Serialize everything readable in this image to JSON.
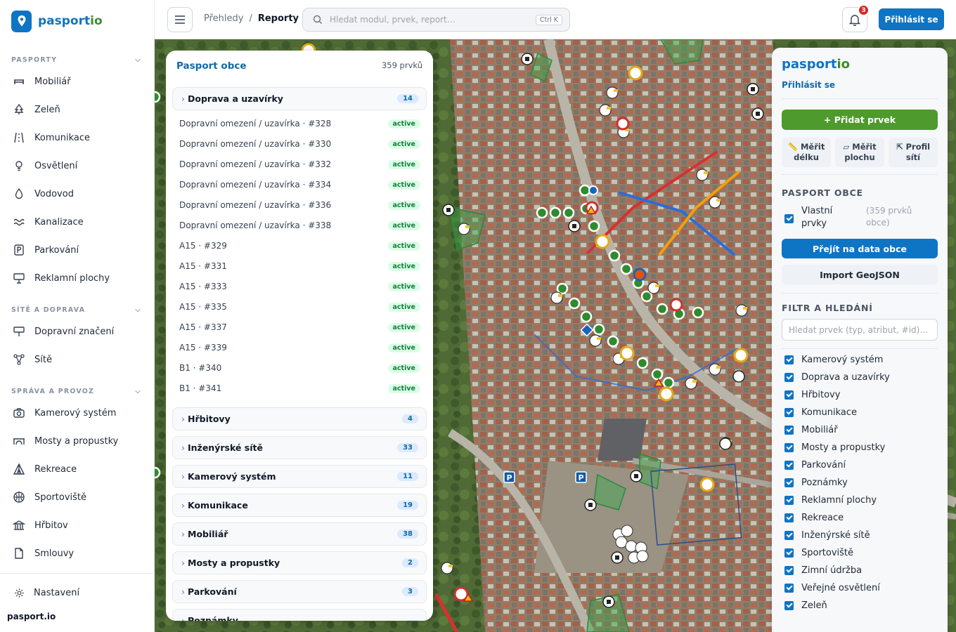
{
  "app": {
    "name_main": "pasport",
    "name_io": "io",
    "footer": "pasport.io"
  },
  "sidebar": {
    "sections": [
      {
        "label": "PASPORTY",
        "items": [
          "Mobiliář",
          "Zeleň",
          "Komunikace",
          "Osvětlení",
          "Vodovod",
          "Kanalizace",
          "Parkování",
          "Reklamní plochy"
        ]
      },
      {
        "label": "SÍTĚ A DOPRAVA",
        "items": [
          "Dopravní značení",
          "Sítě"
        ]
      },
      {
        "label": "SPRÁVA A PROVOZ",
        "items": [
          "Kamerový systém",
          "Mosty a propustky",
          "Rekreace",
          "Sportoviště",
          "Hřbitov",
          "Smlouvy"
        ]
      }
    ],
    "settings": "Nastavení"
  },
  "topbar": {
    "crumb_parent": "Přehledy",
    "crumb_sep": "/",
    "crumb_current": "Reporty",
    "search_placeholder": "Hledat modul, prvek, report…",
    "shortcut": "Ctrl K",
    "notifications": "3",
    "login": "Přihlásit se"
  },
  "list_panel": {
    "title": "Pasport obce",
    "count": "359 prvků",
    "open_group": {
      "name": "Doprava a uzavírky",
      "count": "14"
    },
    "rows": [
      {
        "name": "Dopravní omezení / uzavírka · #328",
        "status": "active"
      },
      {
        "name": "Dopravní omezení / uzavírka · #330",
        "status": "active"
      },
      {
        "name": "Dopravní omezení / uzavírka · #332",
        "status": "active"
      },
      {
        "name": "Dopravní omezení / uzavírka · #334",
        "status": "active"
      },
      {
        "name": "Dopravní omezení / uzavírka · #336",
        "status": "active"
      },
      {
        "name": "Dopravní omezení / uzavírka · #338",
        "status": "active"
      },
      {
        "name": "A15 · #329",
        "status": "active"
      },
      {
        "name": "A15 · #331",
        "status": "active"
      },
      {
        "name": "A15 · #333",
        "status": "active"
      },
      {
        "name": "A15 · #335",
        "status": "active"
      },
      {
        "name": "A15 · #337",
        "status": "active"
      },
      {
        "name": "A15 · #339",
        "status": "active"
      },
      {
        "name": "B1 · #340",
        "status": "active"
      },
      {
        "name": "B1 · #341",
        "status": "active"
      }
    ],
    "groups": [
      {
        "name": "Hřbitovy",
        "count": "4"
      },
      {
        "name": "Inženýrské sítě",
        "count": "33"
      },
      {
        "name": "Kamerový systém",
        "count": "11"
      },
      {
        "name": "Komunikace",
        "count": "19"
      },
      {
        "name": "Mobiliář",
        "count": "38"
      },
      {
        "name": "Mosty a propustky",
        "count": "2"
      },
      {
        "name": "Parkování",
        "count": "3"
      },
      {
        "name": "Poznámky",
        "count": ""
      }
    ]
  },
  "right_panel": {
    "brand_main": "pasport",
    "brand_io": "io",
    "login": "Přihlásit se",
    "add": "+ Přidat prvek",
    "tools": [
      {
        "line1": "Měřit",
        "line2": "délku"
      },
      {
        "line1": "Měřit",
        "line2": "plochu"
      },
      {
        "line1": "Profil",
        "line2": "sítí"
      }
    ],
    "section_pasport": "PASPORT OBCE",
    "own_label_1": "Vlastní",
    "own_label_2": "prvky",
    "own_count_1": "(359 prvků",
    "own_count_2": "obce)",
    "goto_data": "Přejít na data obce",
    "import": "Import GeoJSON",
    "section_filter": "FILTR A HLEDÁNÍ",
    "search_placeholder": "Hledat prvek (typ, atribut, #id)…",
    "filters": [
      "Kamerový systém",
      "Doprava a uzavírky",
      "Hřbitovy",
      "Komunikace",
      "Mobiliář",
      "Mosty a propustky",
      "Parkování",
      "Poznámky",
      "Reklamní plochy",
      "Rekreace",
      "Inženýrské sítě",
      "Sportoviště",
      "Zimní údržba",
      "Veřejné osvětlení",
      "Zeleň"
    ]
  },
  "colors": {
    "brand_blue": "#0e74c4",
    "brand_green": "#3d8d2d",
    "add_green": "#4e9a2c",
    "status_green": "#15803d",
    "badge_red": "#dc2626"
  }
}
